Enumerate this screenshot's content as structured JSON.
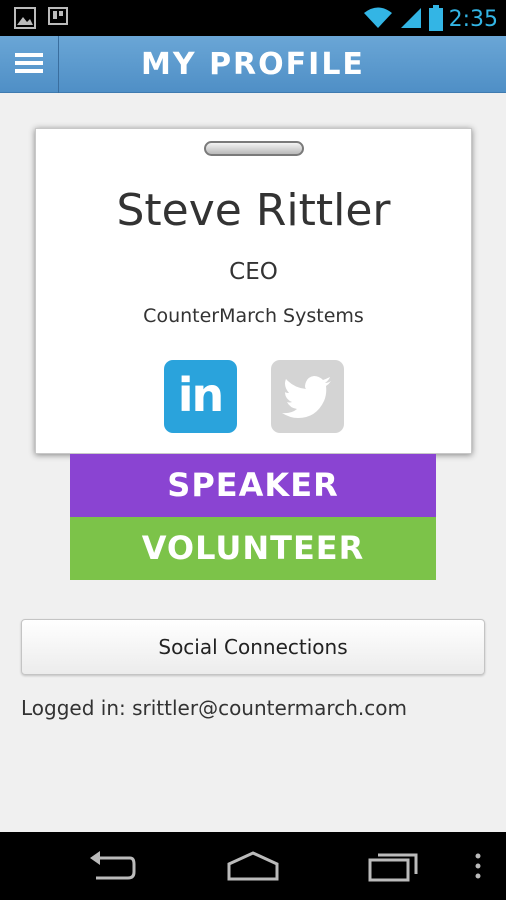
{
  "status_bar": {
    "time": "2:35",
    "left_icons": [
      "image-icon",
      "notification-icon"
    ],
    "right_icons": [
      "wifi-icon",
      "signal-icon",
      "battery-icon"
    ]
  },
  "app_bar": {
    "title": "MY PROFILE",
    "menu_icon": "hamburger-menu-icon"
  },
  "badge": {
    "name": "Steve Rittler",
    "title": "CEO",
    "company": "CounterMarch Systems",
    "social": {
      "linkedin_label": "in",
      "linkedin_color": "#2aa3dc",
      "twitter_color": "#d4d4d4"
    }
  },
  "roles": [
    {
      "label": "SPEAKER",
      "color": "#8a44d2"
    },
    {
      "label": "VOLUNTEER",
      "color": "#7cc349"
    }
  ],
  "social_button": {
    "label": "Social Connections"
  },
  "logged_in_text": "Logged in: srittler@countermarch.com",
  "nav_bar": {
    "icons": [
      "back-icon",
      "home-icon",
      "recent-apps-icon",
      "overflow-menu-icon"
    ]
  }
}
